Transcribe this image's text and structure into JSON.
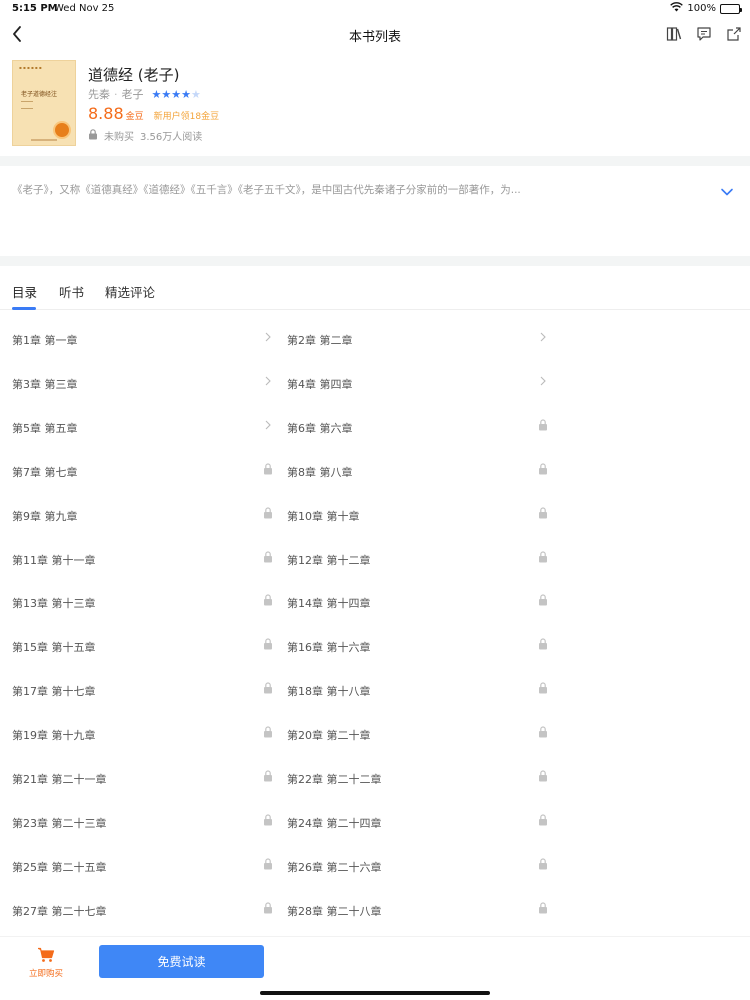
{
  "status_bar": {
    "time": "5:15 PM",
    "date": "Wed Nov 25",
    "battery": "100%"
  },
  "nav": {
    "title": "本书列表"
  },
  "book": {
    "title": "道德经 (老子)",
    "era": "先秦",
    "author": "老子",
    "rating": 4.5,
    "price": "8.88",
    "price_unit": "金豆",
    "promo": "新用户领18金豆",
    "purchase_status": "未购买",
    "readers": "3.56万人阅读",
    "cover_title": "老子道德经注"
  },
  "description": "《老子》，又称《道德真经》《道德经》《五千言》《老子五千文》，是中国古代先秦诸子分家前的一部著作，为...",
  "tabs": [
    {
      "label": "目录",
      "active": true
    },
    {
      "label": "听书",
      "active": false
    },
    {
      "label": "精选评论",
      "active": false
    }
  ],
  "chapters": [
    {
      "label": "第1章 第一章",
      "locked": false
    },
    {
      "label": "第2章 第二章",
      "locked": false
    },
    {
      "label": "第3章 第三章",
      "locked": false
    },
    {
      "label": "第4章 第四章",
      "locked": false
    },
    {
      "label": "第5章 第五章",
      "locked": false
    },
    {
      "label": "第6章 第六章",
      "locked": true
    },
    {
      "label": "第7章 第七章",
      "locked": true
    },
    {
      "label": "第8章 第八章",
      "locked": true
    },
    {
      "label": "第9章 第九章",
      "locked": true
    },
    {
      "label": "第10章 第十章",
      "locked": true
    },
    {
      "label": "第11章 第十一章",
      "locked": true
    },
    {
      "label": "第12章 第十二章",
      "locked": true
    },
    {
      "label": "第13章 第十三章",
      "locked": true
    },
    {
      "label": "第14章 第十四章",
      "locked": true
    },
    {
      "label": "第15章 第十五章",
      "locked": true
    },
    {
      "label": "第16章 第十六章",
      "locked": true
    },
    {
      "label": "第17章 第十七章",
      "locked": true
    },
    {
      "label": "第18章 第十八章",
      "locked": true
    },
    {
      "label": "第19章 第十九章",
      "locked": true
    },
    {
      "label": "第20章 第二十章",
      "locked": true
    },
    {
      "label": "第21章 第二十一章",
      "locked": true
    },
    {
      "label": "第22章 第二十二章",
      "locked": true
    },
    {
      "label": "第23章 第二十三章",
      "locked": true
    },
    {
      "label": "第24章 第二十四章",
      "locked": true
    },
    {
      "label": "第25章 第二十五章",
      "locked": true
    },
    {
      "label": "第26章 第二十六章",
      "locked": true
    },
    {
      "label": "第27章 第二十七章",
      "locked": true
    },
    {
      "label": "第28章 第二十八章",
      "locked": true
    }
  ],
  "bottom": {
    "buy_label": "立即购买",
    "trial_label": "免费试读"
  },
  "colors": {
    "accent_blue": "#3a7bf5",
    "price_orange": "#f46c1b",
    "promo_orange": "#f3a43a"
  },
  "icons": [
    "back-icon",
    "bookshelf-icon",
    "comment-icon",
    "share-icon",
    "lock-icon",
    "chevron-right-icon",
    "chevron-down-icon",
    "cart-icon",
    "wifi-icon",
    "battery-icon"
  ]
}
